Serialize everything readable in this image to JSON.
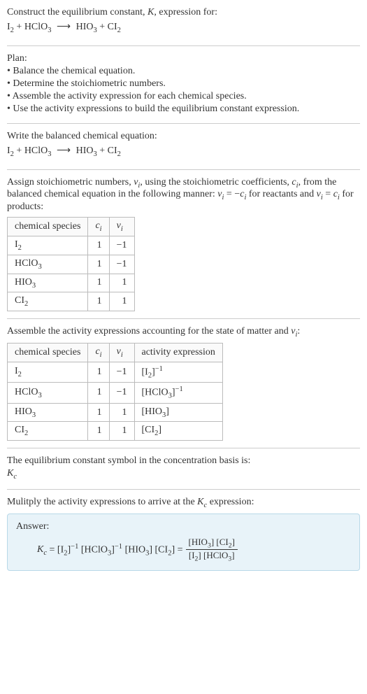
{
  "prompt": {
    "lead": "Construct the equilibrium constant, ",
    "Kvar": "K",
    "lead2": ", expression for:",
    "equation_html": "I<sub>2</sub> + HClO<sub>3</sub> <span class='arrow'>⟶</span> HIO<sub>3</sub> + CI<sub>2</sub>"
  },
  "plan": {
    "title": "Plan:",
    "items": [
      "Balance the chemical equation.",
      "Determine the stoichiometric numbers.",
      "Assemble the activity expression for each chemical species.",
      "Use the activity expressions to build the equilibrium constant expression."
    ]
  },
  "balanced": {
    "lead": "Write the balanced chemical equation:",
    "equation_html": "I<sub>2</sub> + HClO<sub>3</sub> <span class='arrow'>⟶</span> HIO<sub>3</sub> + CI<sub>2</sub>"
  },
  "assign": {
    "text_html": "Assign stoichiometric numbers, <span class='ital'>ν<sub>i</sub></span>, using the stoichiometric coefficients, <span class='ital'>c<sub>i</sub></span>, from the balanced chemical equation in the following manner: <span class='ital'>ν<sub>i</sub></span> = −<span class='ital'>c<sub>i</sub></span> for reactants and <span class='ital'>ν<sub>i</sub></span> = <span class='ital'>c<sub>i</sub></span> for products:",
    "headers": {
      "species": "chemical species",
      "c": "c",
      "v": "ν"
    },
    "rows": [
      {
        "species_html": "I<sub>2</sub>",
        "c": "1",
        "v": "−1"
      },
      {
        "species_html": "HClO<sub>3</sub>",
        "c": "1",
        "v": "−1"
      },
      {
        "species_html": "HIO<sub>3</sub>",
        "c": "1",
        "v": "1"
      },
      {
        "species_html": "CI<sub>2</sub>",
        "c": "1",
        "v": "1"
      }
    ]
  },
  "activity": {
    "lead_html": "Assemble the activity expressions accounting for the state of matter and <span class='ital'>ν<sub>i</sub></span>:",
    "headers": {
      "species": "chemical species",
      "c": "c",
      "v": "ν",
      "act": "activity expression"
    },
    "rows": [
      {
        "species_html": "I<sub>2</sub>",
        "c": "1",
        "v": "−1",
        "act_html": "[I<sub>2</sub>]<sup>−1</sup>"
      },
      {
        "species_html": "HClO<sub>3</sub>",
        "c": "1",
        "v": "−1",
        "act_html": "[HClO<sub>3</sub>]<sup>−1</sup>"
      },
      {
        "species_html": "HIO<sub>3</sub>",
        "c": "1",
        "v": "1",
        "act_html": "[HIO<sub>3</sub>]"
      },
      {
        "species_html": "CI<sub>2</sub>",
        "c": "1",
        "v": "1",
        "act_html": "[CI<sub>2</sub>]"
      }
    ]
  },
  "symbol": {
    "lead": "The equilibrium constant symbol in the concentration basis is:",
    "value_html": "<span class='ital'>K<sub>c</sub></span>"
  },
  "multiply": {
    "lead_html": "Mulitply the activity expressions to arrive at the <span class='ital'>K<sub>c</sub></span> expression:"
  },
  "answer": {
    "label": "Answer:",
    "lhs_html": "<span class='ital'>K<sub>c</sub></span> = [I<sub>2</sub>]<sup>−1</sup> [HClO<sub>3</sub>]<sup>−1</sup> [HIO<sub>3</sub>] [CI<sub>2</sub>] =",
    "frac_num_html": "[HIO<sub>3</sub>] [CI<sub>2</sub>]",
    "frac_den_html": "[I<sub>2</sub>] [HClO<sub>3</sub>]"
  }
}
